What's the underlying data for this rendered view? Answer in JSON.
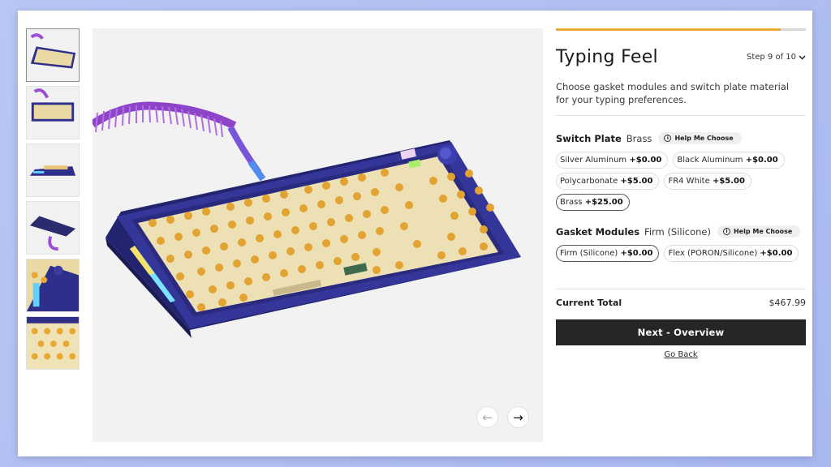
{
  "gallery": {
    "thumbnails": [
      "keyboard-top-view",
      "keyboard-front-view",
      "keyboard-side-view",
      "keyboard-bottom-view",
      "keyboard-corner-closeup",
      "keycaps-closeup"
    ],
    "active_thumbnail": 0,
    "main_image": "purple-keyboard-with-coiled-cable",
    "prev_icon": "←",
    "next_icon": "→"
  },
  "configurator": {
    "progress": 0.9,
    "progress_color": "#f2a830",
    "title": "Typing Feel",
    "step_label": "Step 9 of 10",
    "step_icon": "chevron-down",
    "description": "Choose gasket modules and switch plate material for your typing preferences.",
    "switch_plate": {
      "label": "Switch Plate",
      "selected": "Brass",
      "help": "Help Me Choose",
      "options": [
        {
          "name": "Silver Aluminum",
          "price": "+$0.00"
        },
        {
          "name": "Black Aluminum",
          "price": "+$0.00"
        },
        {
          "name": "Polycarbonate",
          "price": "+$5.00"
        },
        {
          "name": "FR4 White",
          "price": "+$5.00"
        },
        {
          "name": "Brass",
          "price": "+$25.00"
        }
      ]
    },
    "gasket_modules": {
      "label": "Gasket Modules",
      "selected": "Firm (Silicone)",
      "help": "Help Me Choose",
      "options": [
        {
          "name": "Firm (Silicone)",
          "price": "+$0.00"
        },
        {
          "name": "Flex (PORON/Silicone)",
          "price": "+$0.00"
        }
      ]
    },
    "total_label": "Current Total",
    "total_value": "$467.99",
    "next_button": "Next - Overview",
    "back_link": "Go Back"
  }
}
